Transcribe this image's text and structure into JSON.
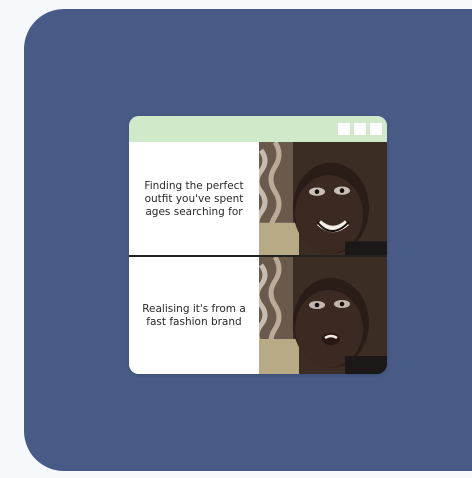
{
  "meme": {
    "top_caption": "Finding the perfect\noutfit you've spent\nages searching for",
    "bottom_caption": "Realising it's from a\nfast fashion brand"
  },
  "window": {
    "titlebar_color": "#cfe9c9",
    "panel_color": "#475b86"
  },
  "icons": {
    "window_controls": [
      "window-button-icon",
      "window-button-icon",
      "window-button-icon"
    ]
  }
}
